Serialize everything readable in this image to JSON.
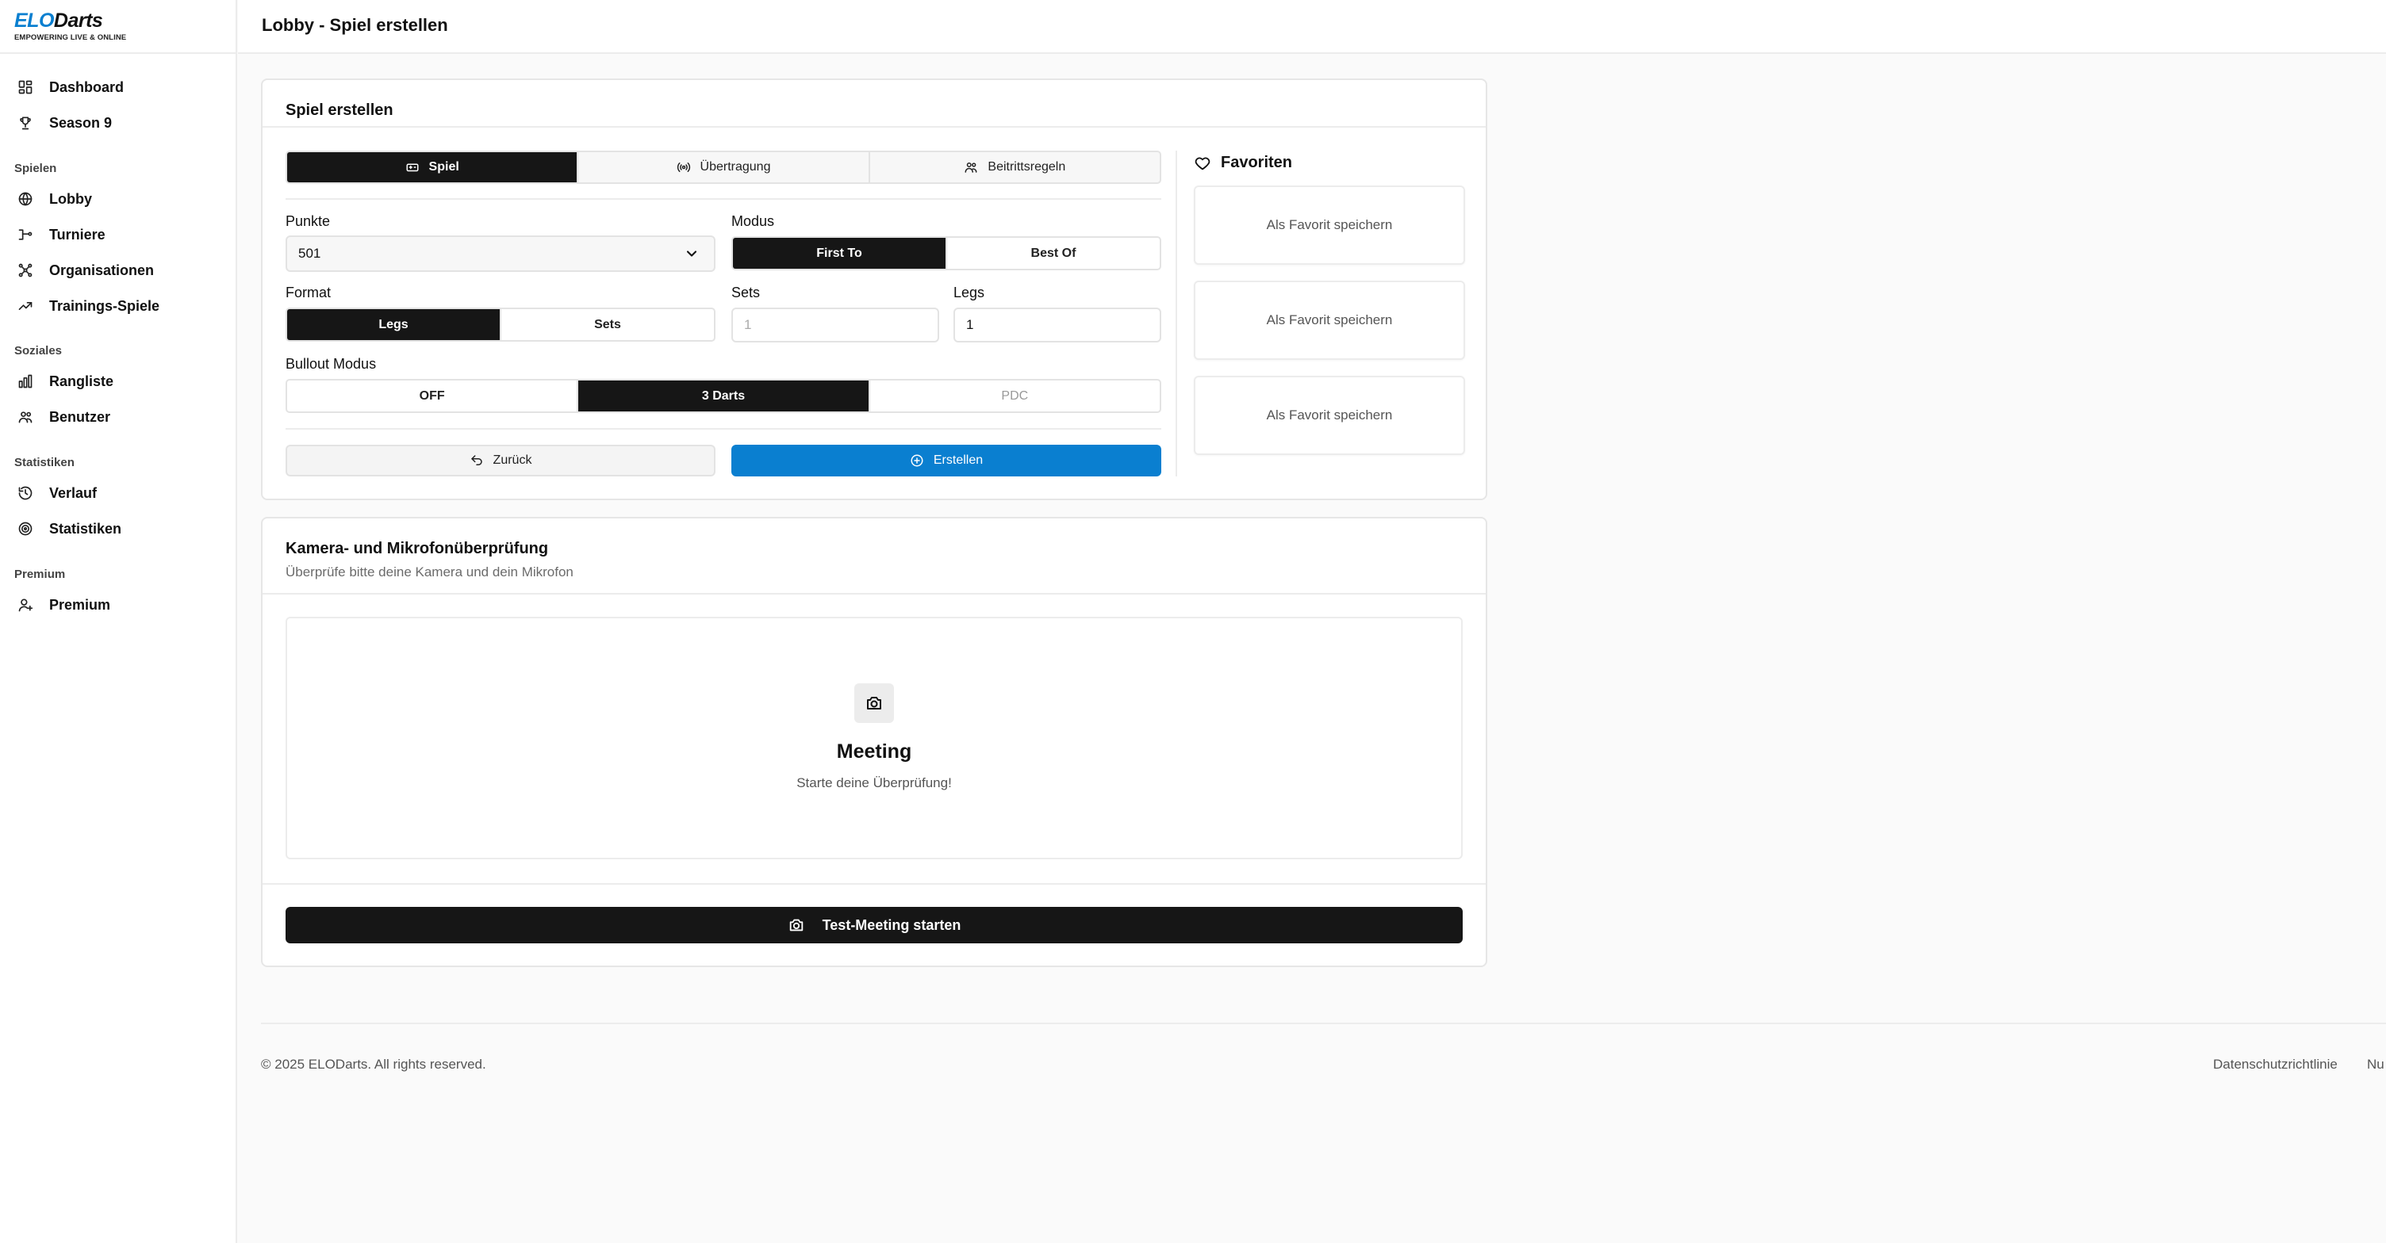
{
  "brand": {
    "name_part1": "ELO",
    "name_part2": "Darts",
    "tagline": "EMPOWERING LIVE & ONLINE",
    "accent": "#0a7fd0"
  },
  "header": {
    "title": "Lobby - Spiel erstellen"
  },
  "sidebar": {
    "top_items": [
      {
        "label": "Dashboard",
        "icon": "dashboard-icon"
      },
      {
        "label": "Season 9",
        "icon": "trophy-icon"
      }
    ],
    "sections": [
      {
        "title": "Spielen",
        "items": [
          {
            "label": "Lobby",
            "icon": "globe-icon"
          },
          {
            "label": "Turniere",
            "icon": "bracket-icon"
          },
          {
            "label": "Organisationen",
            "icon": "network-icon"
          },
          {
            "label": "Trainings-Spiele",
            "icon": "trending-up-icon"
          }
        ]
      },
      {
        "title": "Soziales",
        "items": [
          {
            "label": "Rangliste",
            "icon": "bar-chart-icon"
          },
          {
            "label": "Benutzer",
            "icon": "users-icon"
          }
        ]
      },
      {
        "title": "Statistiken",
        "items": [
          {
            "label": "Verlauf",
            "icon": "history-icon"
          },
          {
            "label": "Statistiken",
            "icon": "target-icon"
          }
        ]
      },
      {
        "title": "Premium",
        "items": [
          {
            "label": "Premium",
            "icon": "user-plus-icon"
          }
        ]
      }
    ]
  },
  "create_game": {
    "title": "Spiel erstellen",
    "tabs": [
      {
        "label": "Spiel",
        "icon": "gamepad-icon",
        "active": true
      },
      {
        "label": "Übertragung",
        "icon": "broadcast-icon",
        "active": false
      },
      {
        "label": "Beitrittsregeln",
        "icon": "users-icon",
        "active": false
      }
    ],
    "punkte": {
      "label": "Punkte",
      "value": "501"
    },
    "modus": {
      "label": "Modus",
      "options": [
        "First To",
        "Best Of"
      ],
      "selected": "First To"
    },
    "format": {
      "label": "Format",
      "options": [
        "Legs",
        "Sets"
      ],
      "selected": "Legs"
    },
    "sets": {
      "label": "Sets",
      "placeholder": "1"
    },
    "legs": {
      "label": "Legs",
      "value": "1"
    },
    "bullout": {
      "label": "Bullout Modus",
      "options": [
        "OFF",
        "3 Darts",
        "PDC"
      ],
      "selected": "3 Darts"
    },
    "back_label": "Zurück",
    "create_label": "Erstellen"
  },
  "favorites": {
    "title": "Favoriten",
    "slots": [
      "Als Favorit speichern",
      "Als Favorit speichern",
      "Als Favorit speichern"
    ]
  },
  "media_check": {
    "title": "Kamera- und Mikrofonüberprüfung",
    "subtitle": "Überprüfe bitte deine Kamera und dein Mikrofon",
    "meeting_title": "Meeting",
    "meeting_subtitle": "Starte deine Überprüfung!",
    "start_label": "Test-Meeting starten"
  },
  "footer": {
    "copyright": "© 2025 ELODarts. All rights reserved.",
    "links": [
      "Datenschutzrichtlinie",
      "Nu"
    ]
  }
}
